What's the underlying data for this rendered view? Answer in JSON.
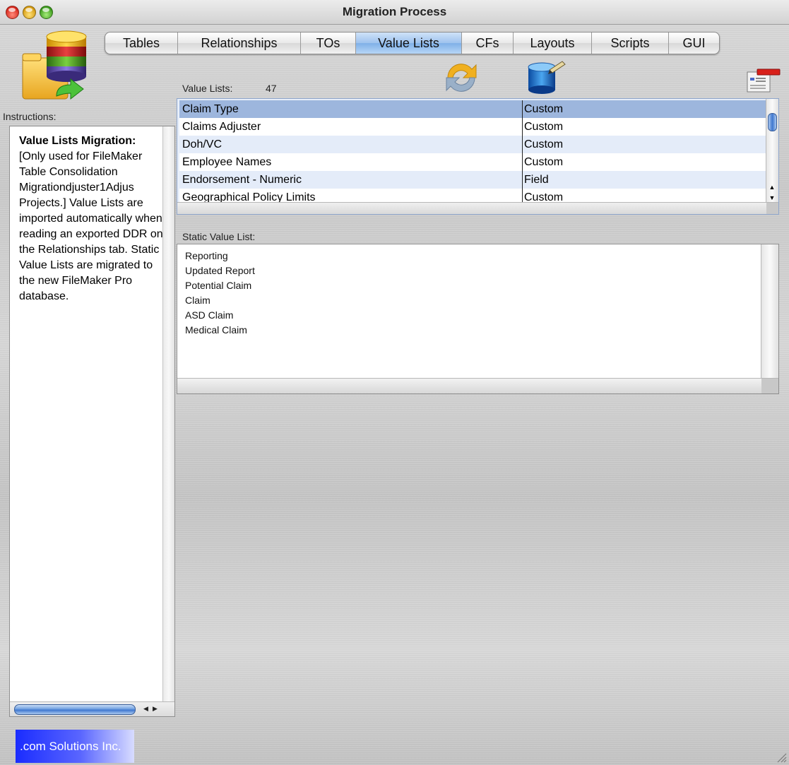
{
  "window": {
    "title": "Migration Process"
  },
  "tabs": [
    {
      "label": "Tables",
      "active": false
    },
    {
      "label": "Relationships",
      "active": false
    },
    {
      "label": "TOs",
      "active": false
    },
    {
      "label": "Value Lists",
      "active": true
    },
    {
      "label": "CFs",
      "active": false
    },
    {
      "label": "Layouts",
      "active": false
    },
    {
      "label": "Scripts",
      "active": false
    },
    {
      "label": "GUI",
      "active": false
    }
  ],
  "instructions": {
    "label": "Instructions:",
    "heading": "Value Lists Migration:",
    "body": "[Only used for FileMaker Table Consolidation Migrationdjuster1Adjus Projects.] Value Lists are imported automatically when reading an exported DDR on the Relationships tab. Static Value Lists are migrated to the new FileMaker Pro database."
  },
  "value_lists": {
    "label": "Value Lists:",
    "count": "47",
    "rows": [
      {
        "name": "Claim Type",
        "type": "Custom",
        "selected": true
      },
      {
        "name": "Claims Adjuster",
        "type": "Custom",
        "selected": false
      },
      {
        "name": "Doh/VC",
        "type": "Custom",
        "selected": false
      },
      {
        "name": "Employee Names",
        "type": "Custom",
        "selected": false
      },
      {
        "name": "Endorsement - Numeric",
        "type": "Field",
        "selected": false
      },
      {
        "name": "Geographical Policy Limits",
        "type": "Custom",
        "selected": false
      }
    ]
  },
  "static_value_list": {
    "label": "Static Value List:",
    "items": [
      "Reporting",
      "Updated Report",
      "Potential Claim",
      "Claim",
      "ASD Claim",
      "Medical Claim"
    ]
  },
  "footer": {
    "company": ".com Solutions Inc."
  },
  "icons": {
    "app_logo": "database-migration-icon",
    "refresh": "refresh-sync-icon",
    "database_edit": "database-edit-icon",
    "layout_card": "layout-card-icon"
  }
}
